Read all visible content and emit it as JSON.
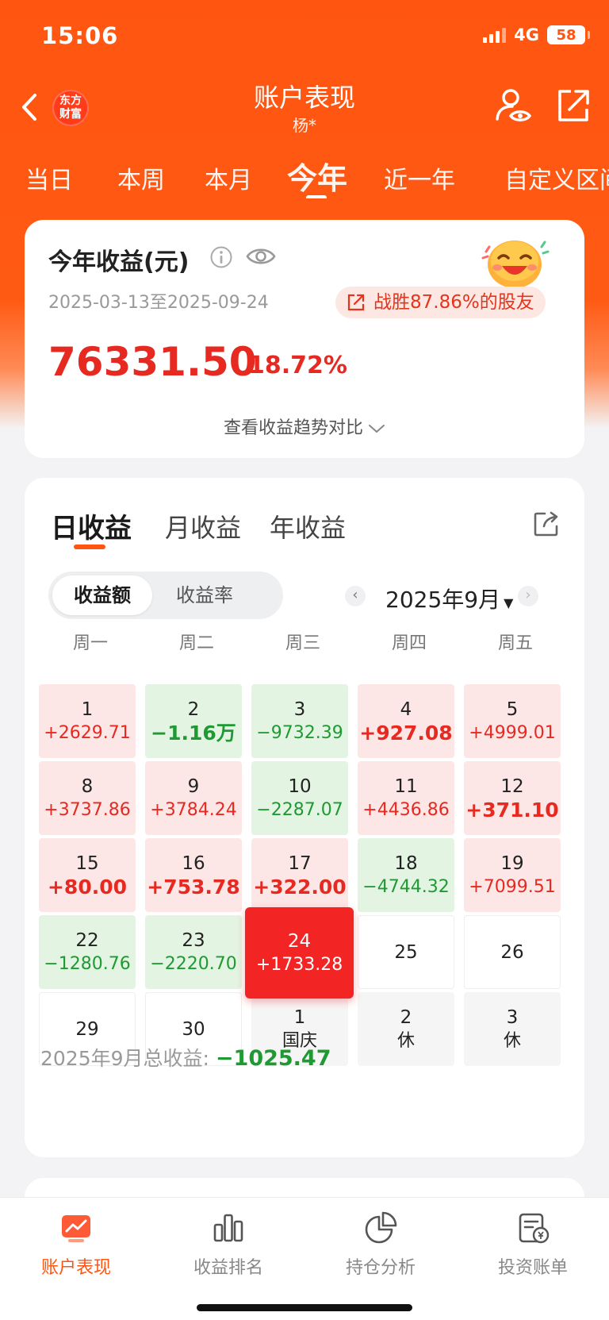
{
  "status": {
    "time": "15:06",
    "network": "4G",
    "battery": "58"
  },
  "header": {
    "title": "账户表现",
    "subtitle": "杨*",
    "logo_line1": "东方",
    "logo_line2": "财富"
  },
  "period_tabs": [
    "当日",
    "本周",
    "本月",
    "今年",
    "近一年",
    "自定义区间"
  ],
  "active_period": "今年",
  "summary": {
    "title": "今年收益(元)",
    "date_range": "2025-03-13至2025-09-24",
    "beat_text": "战胜87.86%的股友",
    "amount": "76331.50",
    "rate": "18.72%",
    "trend_link": "查看收益趋势对比"
  },
  "calendar": {
    "tabs": [
      "日收益",
      "月收益",
      "年收益"
    ],
    "toggle": [
      "收益额",
      "收益率"
    ],
    "month": "2025年9月",
    "weekdays": [
      "周一",
      "周二",
      "周三",
      "周四",
      "周五"
    ],
    "cells": [
      {
        "day": "1",
        "val": "+2629.71",
        "type": "pos"
      },
      {
        "day": "2",
        "val": "−1.16万",
        "type": "neg big"
      },
      {
        "day": "3",
        "val": "−9732.39",
        "type": "neg"
      },
      {
        "day": "4",
        "val": "+927.08",
        "type": "pos big"
      },
      {
        "day": "5",
        "val": "+4999.01",
        "type": "pos"
      },
      {
        "day": "8",
        "val": "+3737.86",
        "type": "pos"
      },
      {
        "day": "9",
        "val": "+3784.24",
        "type": "pos"
      },
      {
        "day": "10",
        "val": "−2287.07",
        "type": "neg"
      },
      {
        "day": "11",
        "val": "+4436.86",
        "type": "pos"
      },
      {
        "day": "12",
        "val": "+371.10",
        "type": "pos big"
      },
      {
        "day": "15",
        "val": "+80.00",
        "type": "pos big"
      },
      {
        "day": "16",
        "val": "+753.78",
        "type": "pos big"
      },
      {
        "day": "17",
        "val": "+322.00",
        "type": "pos big"
      },
      {
        "day": "18",
        "val": "−4744.32",
        "type": "neg"
      },
      {
        "day": "19",
        "val": "+7099.51",
        "type": "pos"
      },
      {
        "day": "22",
        "val": "−1280.76",
        "type": "neg"
      },
      {
        "day": "23",
        "val": "−2220.70",
        "type": "neg"
      },
      {
        "day": "24",
        "val": "+1733.28",
        "type": "today"
      },
      {
        "day": "25",
        "val": "",
        "type": "empty"
      },
      {
        "day": "26",
        "val": "",
        "type": "empty"
      },
      {
        "day": "29",
        "val": "",
        "type": "empty"
      },
      {
        "day": "30",
        "val": "",
        "type": "empty"
      },
      {
        "day": "1",
        "val": "国庆",
        "type": "holiday"
      },
      {
        "day": "2",
        "val": "休",
        "type": "holiday"
      },
      {
        "day": "3",
        "val": "休",
        "type": "holiday"
      }
    ],
    "total_label": "2025年9月总收益:",
    "total_value": "−1025.47"
  },
  "bottom_nav": [
    "账户表现",
    "收益排名",
    "持仓分析",
    "投资账单"
  ],
  "colors": {
    "brand": "#ff5511",
    "gain": "#e62a21",
    "loss": "#1f9a33"
  }
}
